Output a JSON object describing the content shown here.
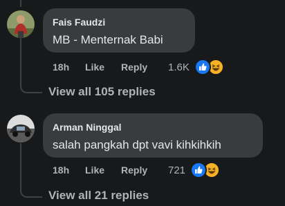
{
  "comments": [
    {
      "author": "Fais Faudzi",
      "text": "MB - Menternak Babi",
      "time": "18h",
      "like_label": "Like",
      "reply_label": "Reply",
      "reaction_count": "1.6K",
      "reactions": [
        "like-icon",
        "haha-icon"
      ],
      "view_replies": "View all 105 replies"
    },
    {
      "author": "Arman Ninggal",
      "text": "salah pangkah dpt vavi kihkihkih",
      "time": "18h",
      "like_label": "Like",
      "reply_label": "Reply",
      "reaction_count": "721",
      "reactions": [
        "like-icon",
        "haha-icon"
      ],
      "view_replies": "View all 21 replies"
    }
  ],
  "colors": {
    "background": "#18191a",
    "bubble": "#3a3b3c",
    "primary_text": "#e4e6eb",
    "secondary_text": "#b0b3b8",
    "like_blue": "#1877f2",
    "haha_yellow": "#f7b125"
  }
}
